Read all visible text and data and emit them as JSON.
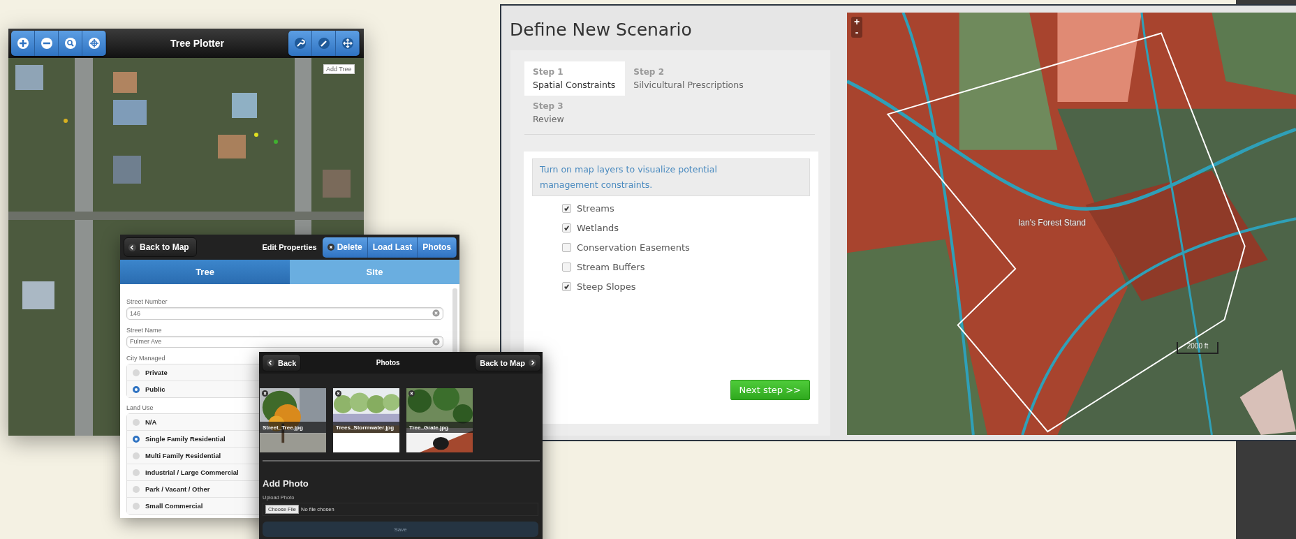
{
  "tree_plotter": {
    "title": "Tree Plotter",
    "tooltip": "Add Tree"
  },
  "edit_properties": {
    "back": "Back to Map",
    "title": "Edit Properties",
    "actions": [
      "Delete",
      "Load Last",
      "Photos"
    ],
    "tabs": [
      {
        "label": "Tree",
        "selected": true
      },
      {
        "label": "Site",
        "selected": false
      }
    ],
    "fields": [
      {
        "label": "Street Number",
        "value": "146"
      },
      {
        "label": "Street Name",
        "value": "Fulmer Ave"
      }
    ],
    "radio_groups": [
      {
        "label": "City Managed",
        "options": [
          {
            "label": "Private",
            "selected": false
          },
          {
            "label": "Public",
            "selected": true
          }
        ]
      },
      {
        "label": "Land Use",
        "options": [
          {
            "label": "N/A",
            "selected": false
          },
          {
            "label": "Single Family Residential",
            "selected": true
          },
          {
            "label": "Multi Family Residential",
            "selected": false
          },
          {
            "label": "Industrial / Large Commercial",
            "selected": false
          },
          {
            "label": "Park / Vacant / Other",
            "selected": false
          },
          {
            "label": "Small Commercial",
            "selected": false
          }
        ]
      }
    ]
  },
  "photos": {
    "back": "Back",
    "title": "Photos",
    "forward": "Back to Map",
    "items": [
      {
        "caption": "Street_Tree.jpg"
      },
      {
        "caption": "Trees_Stormwater.jpg"
      },
      {
        "caption": "Tree_Grate.jpg"
      }
    ],
    "add_title": "Add Photo",
    "upload_label": "Upload Photo",
    "file_button": "Choose File",
    "file_status": "No file chosen",
    "save": {
      "label": "Save",
      "disabled": true
    }
  },
  "scenario": {
    "title": "Define New Scenario",
    "steps": [
      {
        "step": "Step 1",
        "label": "Spatial Constraints",
        "selected": true
      },
      {
        "step": "Step 2",
        "label": "Silvicultural Prescriptions",
        "selected": false
      },
      {
        "step": "Step 3",
        "label": "Review",
        "selected": false
      }
    ],
    "notice": "Turn on map layers to visualize potential management constraints.",
    "layers": [
      {
        "label": "Streams",
        "checked": true
      },
      {
        "label": "Wetlands",
        "checked": true
      },
      {
        "label": "Conservation Easements",
        "checked": false
      },
      {
        "label": "Stream Buffers",
        "checked": false
      },
      {
        "label": "Steep Slopes",
        "checked": true
      }
    ],
    "next": "Next step >>",
    "map": {
      "zoom_in": "+",
      "zoom_out": "-",
      "label": "Ian's Forest Stand",
      "scale": "2000 ft"
    }
  }
}
